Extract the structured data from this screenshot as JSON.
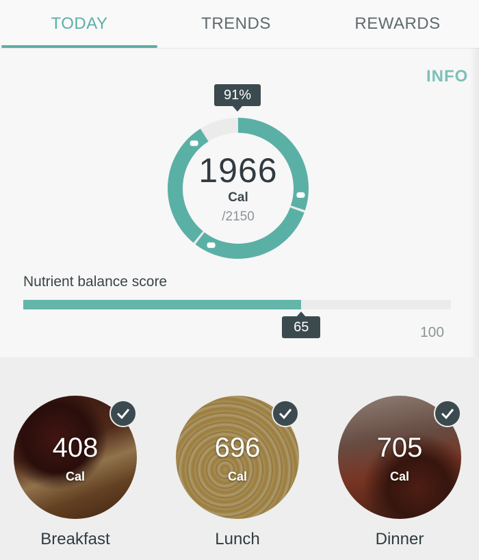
{
  "tabs": [
    {
      "label": "TODAY",
      "active": true
    },
    {
      "label": "TRENDS",
      "active": false
    },
    {
      "label": "REWARDS",
      "active": false
    }
  ],
  "info_link": "INFO",
  "calories": {
    "percent_label": "91%",
    "consumed": "1966",
    "unit": "Cal",
    "goal_label": "/2150",
    "progress": 0.91,
    "segment_icons": [
      "breakfast-icon",
      "lunch-icon",
      "dinner-icon"
    ]
  },
  "nutrient": {
    "label": "Nutrient balance score",
    "score": 65,
    "score_label": "65",
    "max_label": "100"
  },
  "meals": [
    {
      "name": "Breakfast",
      "calories": "408",
      "unit": "Cal",
      "checked": true
    },
    {
      "name": "Lunch",
      "calories": "696",
      "unit": "Cal",
      "checked": true
    },
    {
      "name": "Dinner",
      "calories": "705",
      "unit": "Cal",
      "checked": true
    }
  ],
  "colors": {
    "accent": "#5bb0a6",
    "badge": "#3b4a4f"
  }
}
